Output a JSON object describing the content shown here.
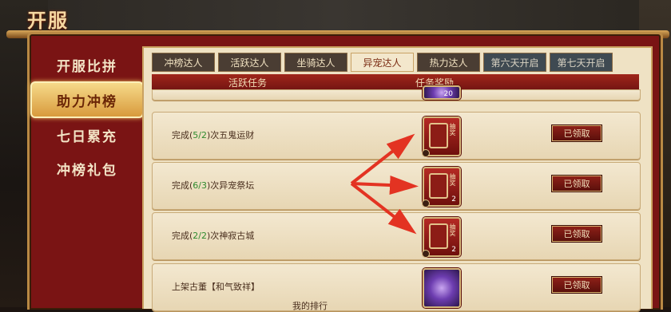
{
  "page": {
    "title": "开服"
  },
  "sidebar": {
    "items": [
      {
        "label": "开服比拼"
      },
      {
        "label": "助力冲榜",
        "active": true
      },
      {
        "label": "七日累充"
      },
      {
        "label": "冲榜礼包"
      }
    ]
  },
  "tabs": [
    {
      "label": "冲榜达人"
    },
    {
      "label": "活跃达人"
    },
    {
      "label": "坐骑达人"
    },
    {
      "label": "异宠达人",
      "active": true
    },
    {
      "label": "热力达人"
    },
    {
      "label": "第六天开启",
      "locked": true
    },
    {
      "label": "第七天开启",
      "locked": true
    }
  ],
  "table": {
    "headers": {
      "task": "活跃任务",
      "reward": "任务奖励"
    },
    "partial_reward_qty": "20",
    "rows": [
      {
        "prefix": "完成(",
        "progress": "5/2",
        "suffix": ")次五鬼运财",
        "reward_tag": "抽奖",
        "reward_qty": "",
        "button": "已领取"
      },
      {
        "prefix": "完成(",
        "progress": "6/3",
        "suffix": ")次异宠祭坛",
        "reward_tag": "抽奖",
        "reward_qty": "2",
        "button": "已领取"
      },
      {
        "prefix": "完成(",
        "progress": "2/2",
        "suffix": ")次神寂古城",
        "reward_tag": "抽奖",
        "reward_qty": "2",
        "button": "已领取"
      },
      {
        "label": "上架古董【和气致祥】",
        "button": "已领取"
      }
    ]
  },
  "footer": {
    "fragment": "我的排行"
  },
  "colors": {
    "accent": "#7a1414",
    "gold": "#d89a3c",
    "progress_green": "#2f8a2f",
    "arrow_red": "#e33322"
  }
}
